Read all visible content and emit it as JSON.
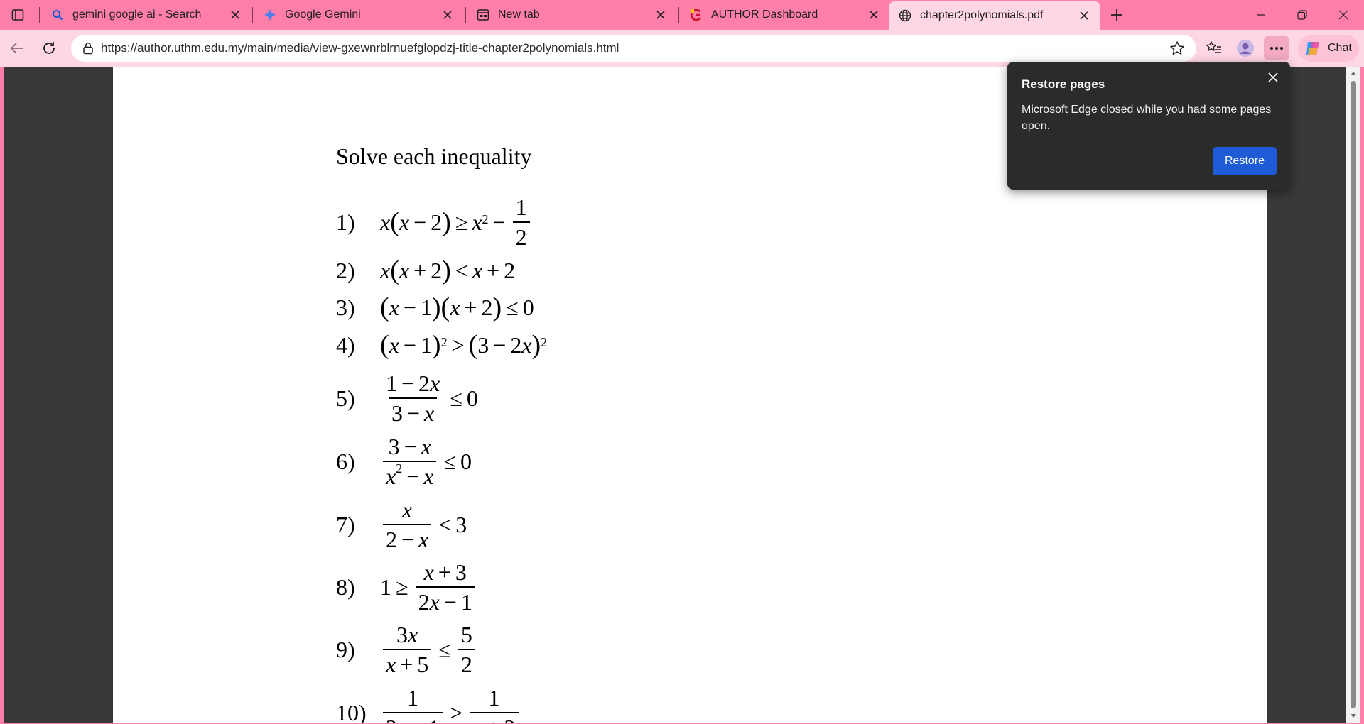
{
  "tabs": [
    {
      "title": "gemini google ai - Search",
      "icon": "search-icon"
    },
    {
      "title": "Google Gemini",
      "icon": "gemini-icon"
    },
    {
      "title": "New tab",
      "icon": "newtab-icon"
    },
    {
      "title": "AUTHOR Dashboard",
      "icon": "author-icon"
    },
    {
      "title": "chapter2polynomials.pdf",
      "icon": "globe-icon",
      "active": true
    }
  ],
  "address": {
    "url": "https://author.uthm.edu.my/main/media/view-gxewnrblrnuefglopdzj-title-chapter2polynomials.html"
  },
  "toolbar": {
    "chat_label": "Chat"
  },
  "colors": {
    "tabstrip": "#ff7fa8",
    "toolbar": "#ffd6e4",
    "popup": "#2b2b2b",
    "restore_button": "#1f5bd6"
  },
  "document": {
    "heading": "Solve each inequality",
    "problems": [
      {
        "num": "1)"
      },
      {
        "num": "2)"
      },
      {
        "num": "3)"
      },
      {
        "num": "4)"
      },
      {
        "num": "5)"
      },
      {
        "num": "6)"
      },
      {
        "num": "7)"
      },
      {
        "num": "8)"
      },
      {
        "num": "9)"
      },
      {
        "num": "10)"
      }
    ]
  },
  "popup": {
    "title": "Restore pages",
    "message": "Microsoft Edge closed while you had some pages open.",
    "button": "Restore"
  }
}
